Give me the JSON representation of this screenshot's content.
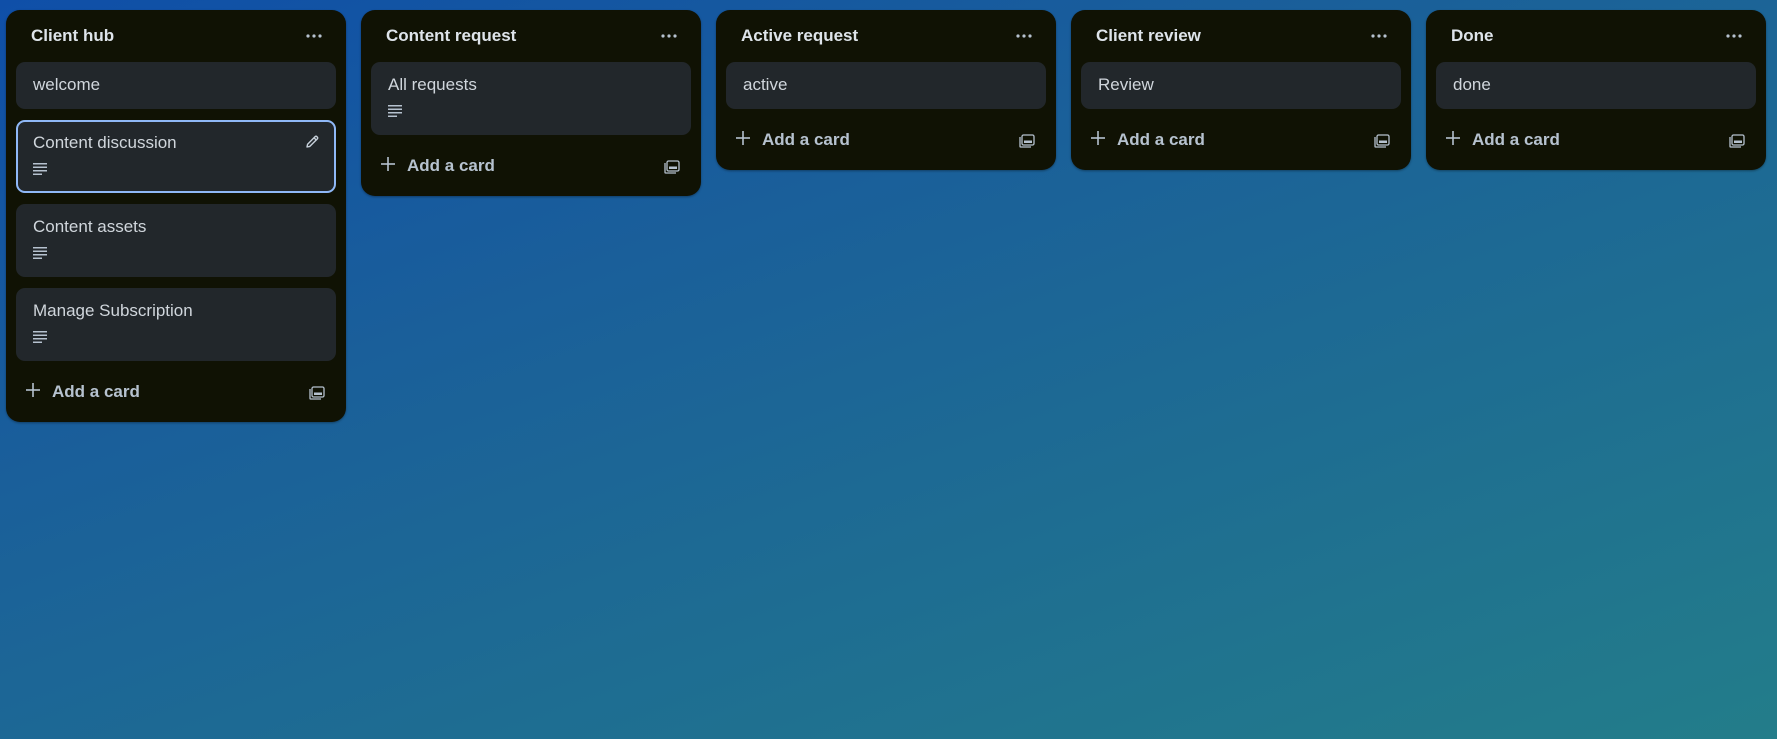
{
  "lists": [
    {
      "title": "Client hub",
      "add_card_label": "Add a card",
      "cards": [
        {
          "title": "welcome",
          "has_description": false
        },
        {
          "title": "Content discussion",
          "has_description": true,
          "focused": true
        },
        {
          "title": "Content assets",
          "has_description": true
        },
        {
          "title": "Manage Subscription",
          "has_description": true
        }
      ]
    },
    {
      "title": "Content request",
      "add_card_label": "Add a card",
      "cards": [
        {
          "title": "All requests",
          "has_description": true
        }
      ]
    },
    {
      "title": "Active request",
      "add_card_label": "Add a card",
      "cards": [
        {
          "title": "active",
          "has_description": false
        }
      ]
    },
    {
      "title": "Client review",
      "add_card_label": "Add a card",
      "cards": [
        {
          "title": "Review",
          "has_description": false
        }
      ]
    },
    {
      "title": "Done",
      "add_card_label": "Add a card",
      "cards": [
        {
          "title": "done",
          "has_description": false
        }
      ]
    }
  ],
  "icons": {
    "list_menu": "ellipsis-icon",
    "description": "description-icon",
    "edit": "pencil-icon",
    "add": "plus-icon",
    "template": "card-template-icon"
  },
  "colors": {
    "list_bg": "#101204",
    "card_bg": "#22272b",
    "focus_border": "#8fb8f6",
    "text_primary": "#d0d6dc",
    "text_muted": "#b6c2cf"
  }
}
